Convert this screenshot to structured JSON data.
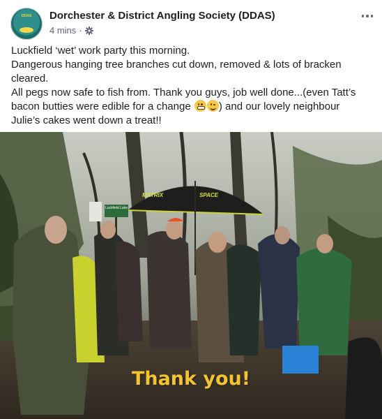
{
  "page": {
    "name": "Dorchester & District Angling Society (DDAS)",
    "timestamp": "4 mins",
    "separator": "·",
    "audience_icon": "gear-icon",
    "more_icon": "more-options-icon"
  },
  "post": {
    "lines": [
      "Luckfield ‘wet’ work party this morning.",
      "Dangerous hanging tree branches cut down, removed & lots of bracken",
      "cleared.",
      "All pegs now safe to fish from. Thank you guys, job well done...(even Tatt’s",
      "bacon butties were edible for a change",
      ") and our lovely neighbour",
      "Julie’s cakes went down a treat!!"
    ],
    "emojis": [
      "grinning-face-emoji",
      "winking-face-emoji"
    ]
  },
  "photo": {
    "overlay_text": "Thank you!",
    "sign_text": "Luckfield Lake",
    "umbrella_texts": [
      "MATRIX",
      "SPACE"
    ],
    "overlay_color": "#f4c430"
  }
}
